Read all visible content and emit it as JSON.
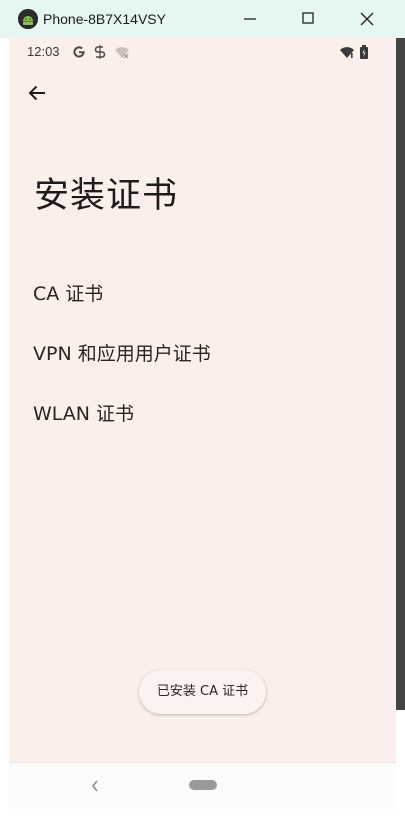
{
  "window": {
    "title": "Phone-8B7X14VSY",
    "icons": [
      "android-icon",
      "minimize-icon",
      "maximize-icon",
      "close-icon"
    ]
  },
  "status_bar": {
    "time": "12:03",
    "icons": [
      "google-icon",
      "sync-icon",
      "wifi-off-icon",
      "wifi-icon",
      "battery-icon"
    ]
  },
  "header": {
    "back_icon": "arrow-left-icon",
    "title": "安装证书"
  },
  "list": {
    "items": [
      {
        "label": "CA 证书"
      },
      {
        "label": "VPN 和应用用户证书"
      },
      {
        "label": "WLAN 证书"
      }
    ]
  },
  "actions": {
    "installed_label": "已安装 CA 证书"
  },
  "nav_bar": {
    "icons": [
      "nav-back-icon",
      "nav-home-pill"
    ]
  },
  "colors": {
    "titlebar_bg": "#e6f7f2",
    "screen_bg": "#fbefec",
    "text_primary": "#1e1b1b"
  }
}
